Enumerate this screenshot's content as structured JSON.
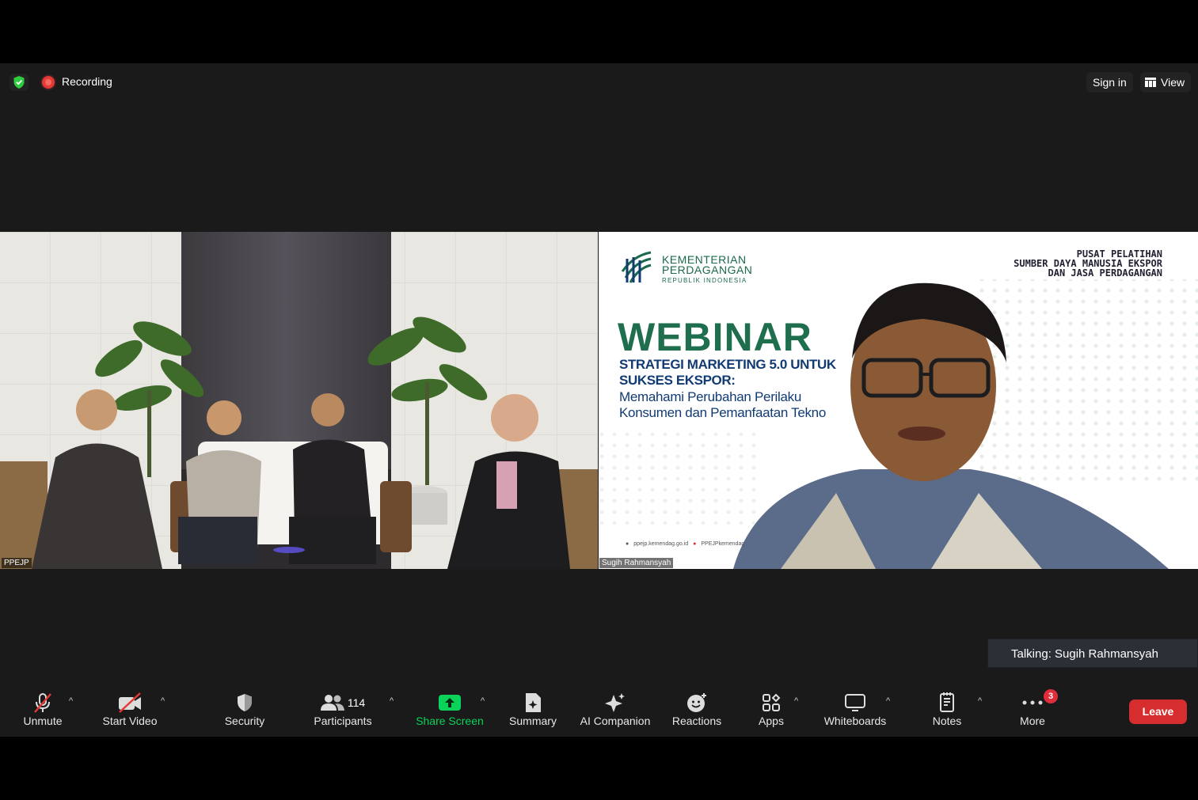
{
  "topbar": {
    "recording_label": "Recording",
    "signin_label": "Sign in",
    "view_label": "View"
  },
  "videos": {
    "left_name": "PPEJP",
    "right_name": "Sugih Rahmansyah"
  },
  "slide": {
    "org_line1": "KEMENTERIAN",
    "org_line2": "PERDAGANGAN",
    "org_line3": "REPUBLIK INDONESIA",
    "pusat_line1": "PUSAT PELATIHAN",
    "pusat_line2": "SUMBER DAYA MANUSIA EKSPOR",
    "pusat_line3": "DAN JASA PERDAGANGAN",
    "heading": "WEBINAR",
    "title_line1": "STRATEGI MARKETING 5.0 UNTUK",
    "title_line2": "SUKSES EKSPOR:",
    "subtitle_line1": "Memahami Perubahan Perilaku",
    "subtitle_line2": "Konsumen dan Pemanfaatan Tekno",
    "footer_web": "ppejp.kemendag.go.id",
    "footer_yt": "PPEJPkemendag"
  },
  "talking": {
    "label": "Talking: Sugih Rahmansyah"
  },
  "toolbar": {
    "unmute": "Unmute",
    "start_video": "Start Video",
    "security": "Security",
    "participants": "Participants",
    "participants_count": "114",
    "share_screen": "Share Screen",
    "summary": "Summary",
    "ai_companion": "AI Companion",
    "reactions": "Reactions",
    "apps": "Apps",
    "whiteboards": "Whiteboards",
    "notes": "Notes",
    "more": "More",
    "more_badge": "3",
    "leave": "Leave"
  },
  "colors": {
    "background": "#1a1a1a",
    "share_green": "#0bd35a",
    "leave_red": "#d62e2e",
    "badge_red": "#e02d3c",
    "shield_green": "#2ecc40",
    "slide_green": "#1f6e4d",
    "slide_blue": "#123b74"
  },
  "icons": [
    "shield-check-icon",
    "record-icon",
    "grid-view-icon",
    "microphone-muted-icon",
    "video-muted-icon",
    "security-shield-icon",
    "participants-icon",
    "share-screen-icon",
    "summary-icon",
    "ai-sparkle-icon",
    "reaction-icon",
    "apps-icon",
    "whiteboard-icon",
    "notes-icon",
    "more-dots-icon",
    "chevron-up-icon"
  ]
}
